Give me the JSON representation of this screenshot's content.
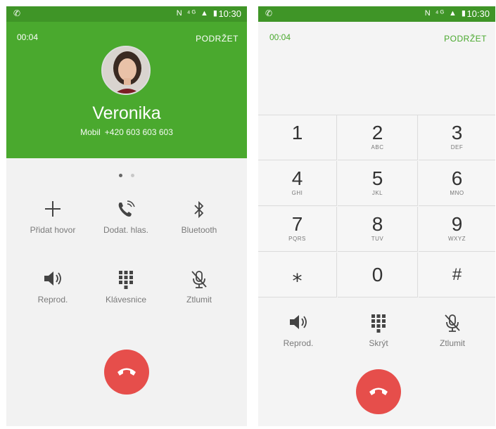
{
  "status_bar": {
    "time": "10:30",
    "phone_glyph": "✆",
    "icons": "N ⁴ᴳ ▲ ▮"
  },
  "left_screen": {
    "call_timer": "00:04",
    "hold_label": "PODRŽET",
    "caller_name": "Veronika",
    "caller_label": "Mobil",
    "caller_number": "+420 603 603 603",
    "page_indicator_colors": [
      "#666666",
      "#c8c8c8"
    ],
    "actions": [
      {
        "label": "Přidat hovor",
        "icon": "add-icon"
      },
      {
        "label": "Dodat. hlas.",
        "icon": "extra-volume-icon"
      },
      {
        "label": "Bluetooth",
        "icon": "bluetooth-icon"
      },
      {
        "label": "Reprod.",
        "icon": "speaker-icon"
      },
      {
        "label": "Klávesnice",
        "icon": "keypad-icon"
      },
      {
        "label": "Ztlumit",
        "icon": "mute-icon"
      }
    ]
  },
  "right_screen": {
    "call_timer": "00:04",
    "hold_label": "PODRŽET",
    "keys": [
      {
        "num": "1",
        "letters": ""
      },
      {
        "num": "2",
        "letters": "ABC"
      },
      {
        "num": "3",
        "letters": "DEF"
      },
      {
        "num": "4",
        "letters": "GHI"
      },
      {
        "num": "5",
        "letters": "JKL"
      },
      {
        "num": "6",
        "letters": "MNO"
      },
      {
        "num": "7",
        "letters": "PQRS"
      },
      {
        "num": "8",
        "letters": "TUV"
      },
      {
        "num": "9",
        "letters": "WXYZ"
      },
      {
        "num": "⁎",
        "letters": ""
      },
      {
        "num": "0",
        "letters": ""
      },
      {
        "num": "#",
        "letters": ""
      }
    ],
    "actions": [
      {
        "label": "Reprod.",
        "icon": "speaker-icon"
      },
      {
        "label": "Skrýt",
        "icon": "keypad-icon"
      },
      {
        "label": "Ztlumit",
        "icon": "mute-icon"
      }
    ]
  },
  "colors": {
    "header_green": "#4aa92e",
    "status_green": "#3f9527",
    "end_call_red": "#e64e4b"
  }
}
